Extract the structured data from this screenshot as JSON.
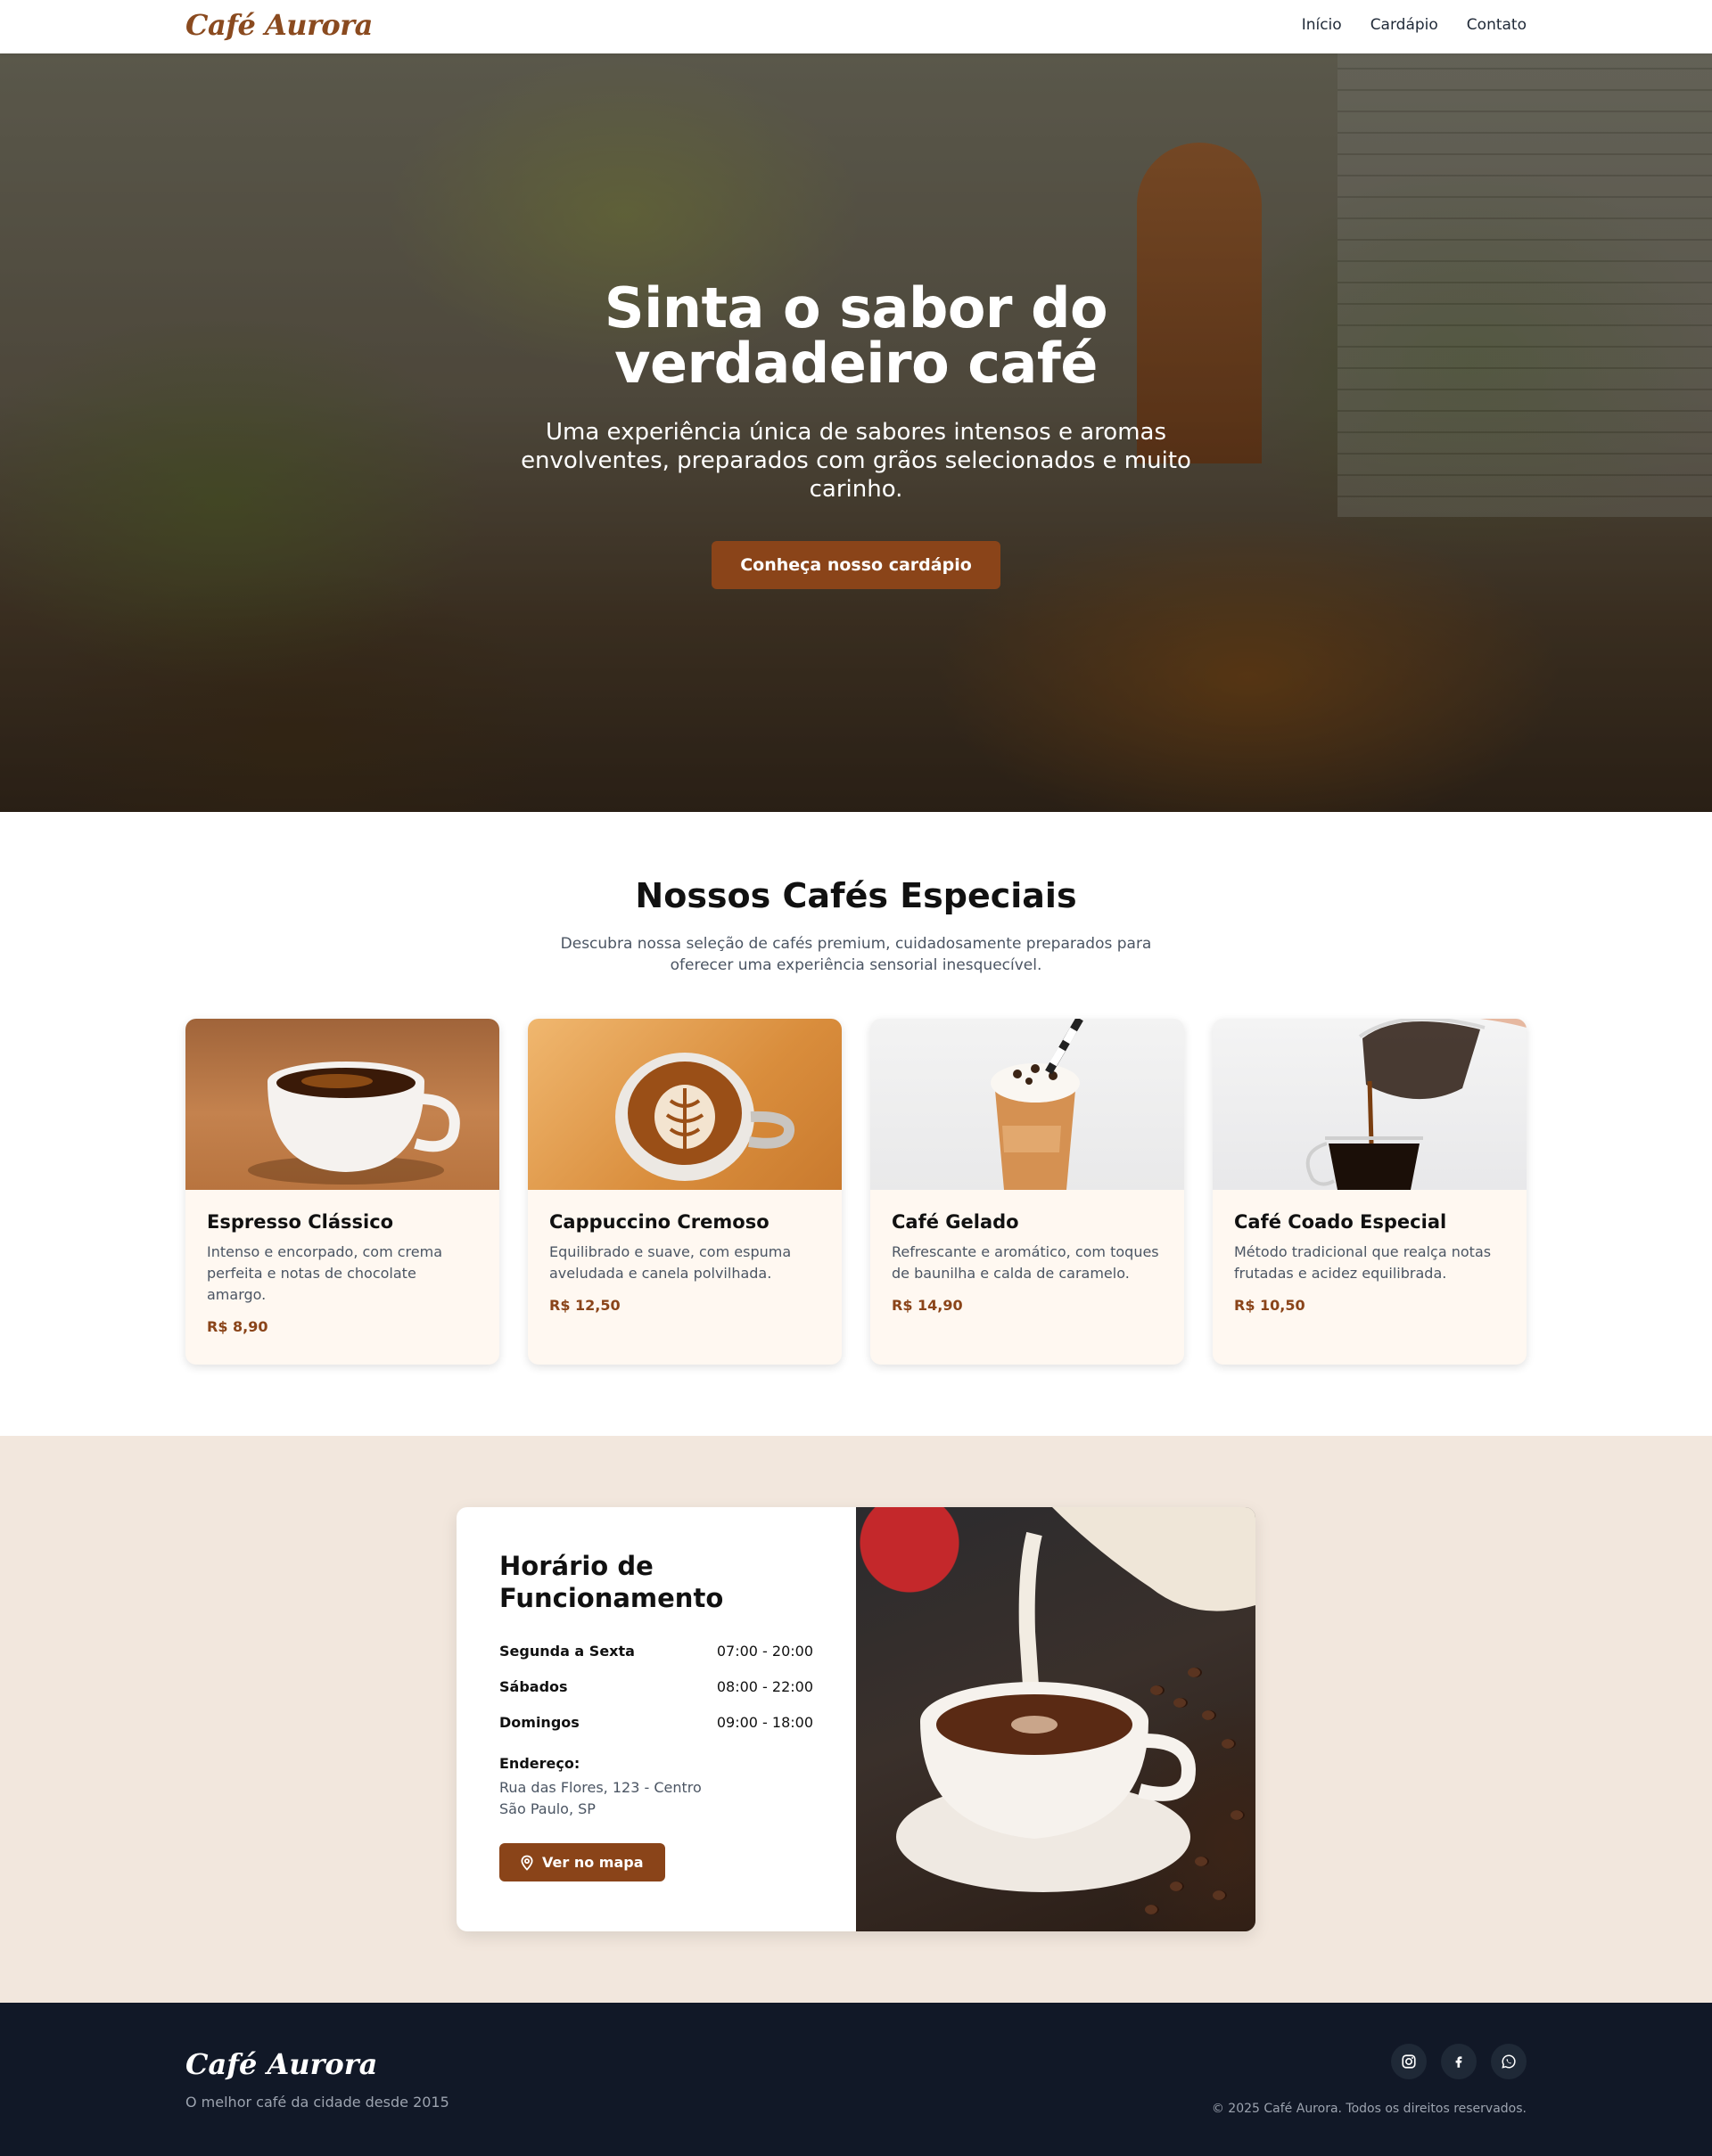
{
  "nav": {
    "brand": "Café Aurora",
    "links": [
      "Início",
      "Cardápio",
      "Contato"
    ]
  },
  "hero": {
    "title_line1": "Sinta o sabor do",
    "title_line2": "verdadeiro café",
    "subtitle": "Uma experiência única de sabores intensos e aromas envolventes, preparados com grãos selecionados e muito carinho.",
    "cta": "Conheça nosso cardápio"
  },
  "specials": {
    "title": "Nossos Cafés Especiais",
    "subtitle": "Descubra nossa seleção de cafés premium, cuidadosamente preparados para oferecer uma experiência sensorial inesquecível.",
    "items": [
      {
        "name": "Espresso Clássico",
        "description": "Intenso e encorpado, com crema perfeita e notas de chocolate amargo.",
        "price": "R$ 8,90"
      },
      {
        "name": "Cappuccino Cremoso",
        "description": "Equilibrado e suave, com espuma aveludada e canela polvilhada.",
        "price": "R$ 12,50"
      },
      {
        "name": "Café Gelado",
        "description": "Refrescante e aromático, com toques de baunilha e calda de caramelo.",
        "price": "R$ 14,90"
      },
      {
        "name": "Café Coado Especial",
        "description": "Método tradicional que realça notas frutadas e acidez equilibrada.",
        "price": "R$ 10,50"
      }
    ]
  },
  "hours": {
    "title": "Horário de Funcionamento",
    "rows": [
      {
        "day": "Segunda a Sexta",
        "time": "07:00 - 20:00"
      },
      {
        "day": "Sábados",
        "time": "08:00 - 22:00"
      },
      {
        "day": "Domingos",
        "time": "09:00 - 18:00"
      }
    ],
    "address_label": "Endereço:",
    "address_line1": "Rua das Flores, 123 - Centro",
    "address_line2": "São Paulo, SP",
    "map_button": "Ver no mapa"
  },
  "footer": {
    "brand": "Café Aurora",
    "tagline": "O melhor café da cidade desde 2015",
    "copyright": "© 2025 Café Aurora. Todos os direitos reservados.",
    "social_icons": [
      "instagram-icon",
      "facebook-icon",
      "whatsapp-icon"
    ]
  },
  "colors": {
    "accent": "#8a4419",
    "footer_bg": "#111827",
    "hours_bg": "#f2e7dd",
    "card_bg": "#fff8f1"
  }
}
